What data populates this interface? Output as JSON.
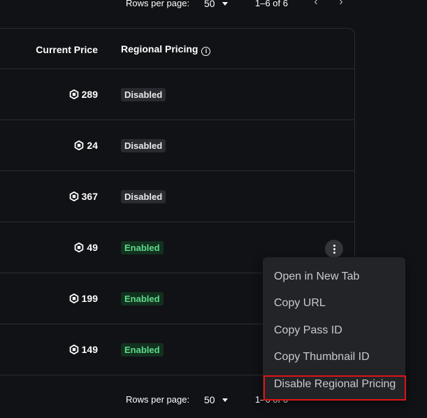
{
  "pagination_top": {
    "rows_per_page_label": "Rows per page:",
    "rows_per_page_value": "50",
    "range_text": "1–6 of 6",
    "prev_icon": "‹",
    "next_icon": "›"
  },
  "pagination_bottom": {
    "rows_per_page_label": "Rows per page:",
    "rows_per_page_value": "50",
    "range_text": "1–6 of 6",
    "prev_icon": "‹",
    "next_icon": "›"
  },
  "table": {
    "headers": {
      "current_price": "Current Price",
      "regional_pricing": "Regional Pricing",
      "info_icon": "i"
    },
    "rows": [
      {
        "price": "289",
        "status": "Disabled"
      },
      {
        "price": "24",
        "status": "Disabled"
      },
      {
        "price": "367",
        "status": "Disabled"
      },
      {
        "price": "49",
        "status": "Enabled"
      },
      {
        "price": "199",
        "status": "Enabled"
      },
      {
        "price": "149",
        "status": "Enabled"
      }
    ]
  },
  "context_menu": {
    "items": [
      "Open in New Tab",
      "Copy URL",
      "Copy Pass ID",
      "Copy Thumbnail ID",
      "Disable Regional Pricing"
    ]
  },
  "colors": {
    "background": "#111216",
    "enabled_text": "#5fd98a",
    "enabled_bg": "#12321f",
    "disabled_bg": "#2a2b30",
    "menu_bg": "#232428",
    "highlight": "#e01414"
  }
}
